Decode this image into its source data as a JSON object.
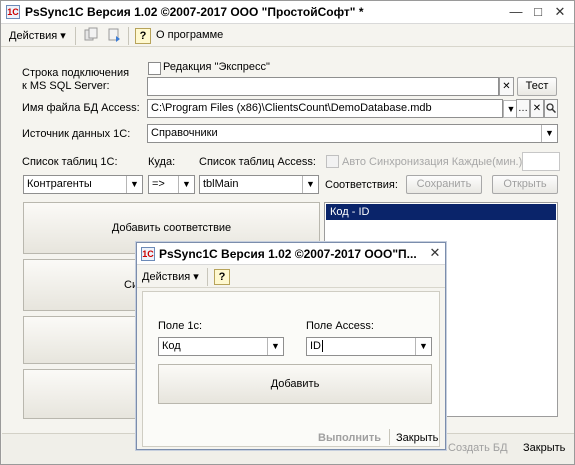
{
  "window": {
    "title": "PsSync1C Версия 1.02 ©2007-2017 ООО \"ПростойСофт\" *",
    "controls": {
      "minimize": "—",
      "maximize": "□",
      "close": "✕"
    }
  },
  "toolbar": {
    "actions_label": "Действия",
    "help_label": "?",
    "about_label": "О программе"
  },
  "form": {
    "conn_label_1": "Строка подключения",
    "conn_label_2": "к MS SQL Server:",
    "express_label": "Редакция \"Экспресс\"",
    "conn_value": "",
    "test_button": "Тест",
    "access_label": "Имя файла БД Access:",
    "access_value": "C:\\Program Files (x86)\\ClientsCount\\DemoDatabase.mdb",
    "source_label": "Источник данных 1С:",
    "source_value": "Справочники",
    "tables1c_label": "Список таблиц 1С:",
    "where_label": "Куда:",
    "tables_access_label": "Список таблиц Access:",
    "autosync_label": "Авто Синхронизация Каждые(мин.)",
    "table1c_value": "Контрагенты",
    "arrow_value": "=>",
    "table_access_value": "tblMain",
    "matches_label": "Соответствия:",
    "save_button": "Сохранить",
    "open_button": "Открыть",
    "add_match_button": "Добавить соответствие",
    "hidden_btn_partial": "Си",
    "matches_list": [
      "Код - ID"
    ]
  },
  "statusbar": {
    "create_db": "Создать БД",
    "close": "Закрыть"
  },
  "dialog": {
    "title": "PsSync1C Версия 1.02 ©2007-2017 ООО\"П...",
    "actions_label": "Действия",
    "help_label": "?",
    "field1c_label": "Поле 1с:",
    "field1c_value": "Код",
    "field_access_label": "Поле Access:",
    "field_access_value": "ID",
    "add_button": "Добавить",
    "execute_button": "Выполнить",
    "close_button": "Закрыть"
  }
}
